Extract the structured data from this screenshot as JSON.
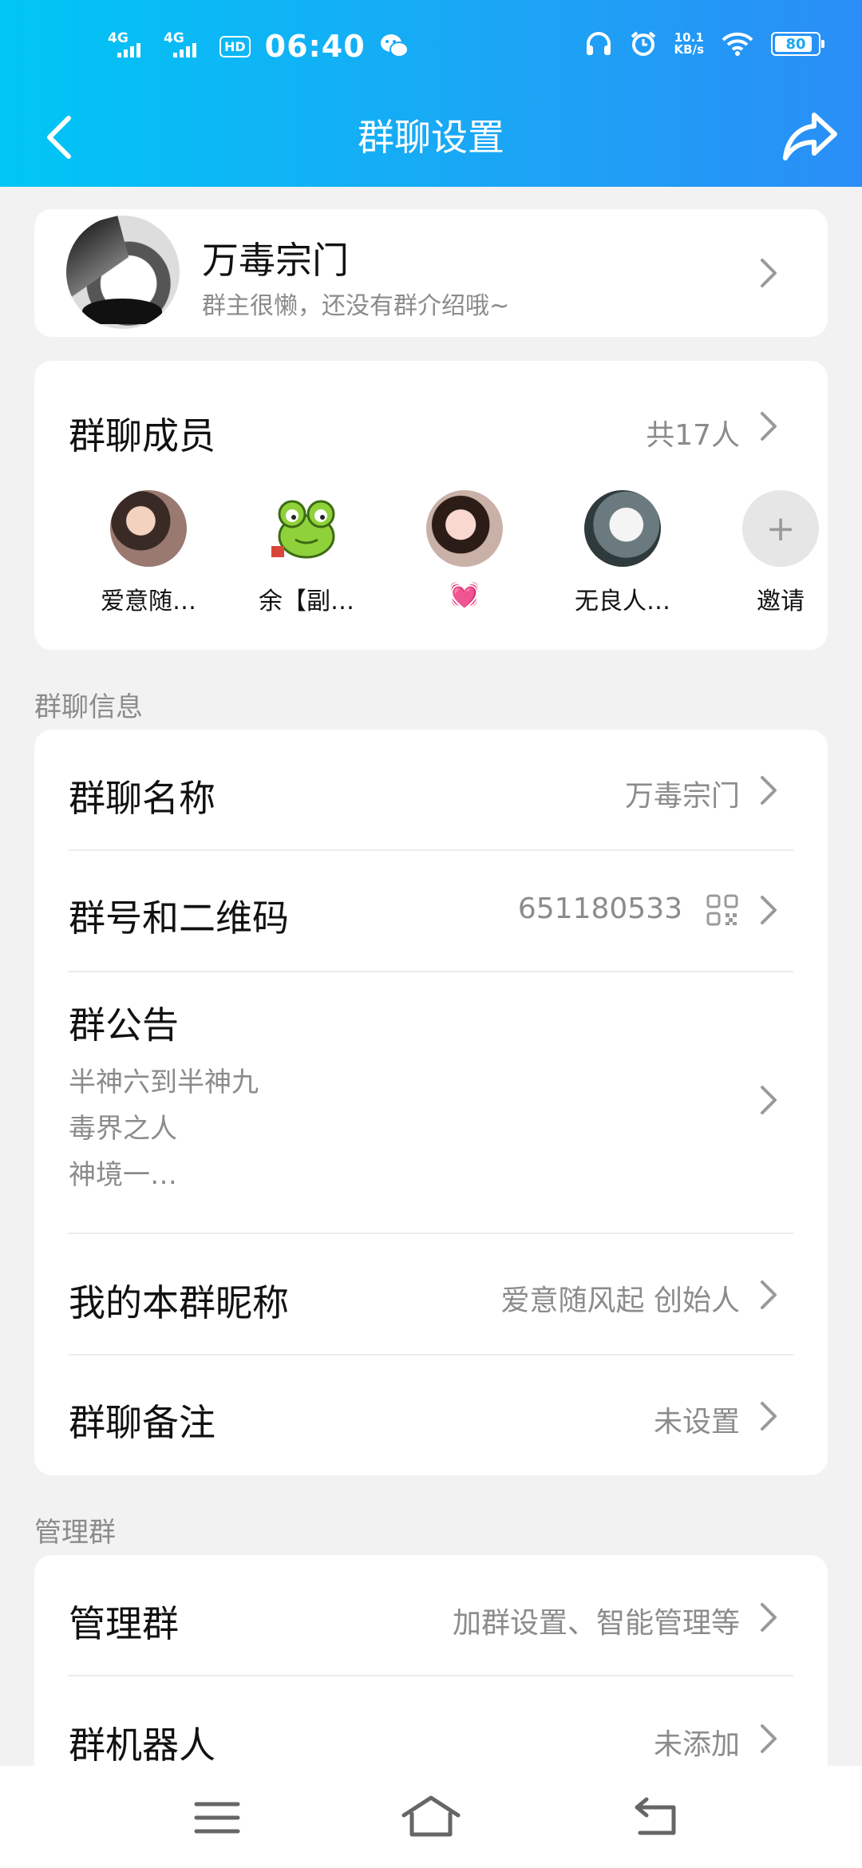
{
  "status_bar": {
    "signal1": "4G",
    "signal2": "4G",
    "hd": "HD",
    "time": "06:40",
    "speed_value": "10.1",
    "speed_unit": "KB/s",
    "battery": "80"
  },
  "header": {
    "title": "群聊设置",
    "back_icon": "chevron-left-icon",
    "share_icon": "share-forward-icon"
  },
  "group": {
    "name": "万毒宗门",
    "description": "群主很懒，还没有群介绍哦~"
  },
  "members_section": {
    "title": "群聊成员",
    "count": "共17人",
    "members": [
      {
        "name": "爱意随…"
      },
      {
        "name": "余【副…"
      },
      {
        "name": "💓"
      },
      {
        "name": "无良人…"
      }
    ],
    "invite_label": "邀请",
    "invite_icon": "+"
  },
  "info_section": {
    "label": "群聊信息",
    "rows": {
      "name": {
        "title": "群聊名称",
        "value": "万毒宗门"
      },
      "number": {
        "title": "群号和二维码",
        "value": "651180533"
      },
      "notice": {
        "title": "群公告",
        "lines": [
          "半神六到半神九",
          "毒界之人",
          "神境一…"
        ]
      },
      "nickname": {
        "title": "我的本群昵称",
        "value": "爱意随风起 创始人"
      },
      "remark": {
        "title": "群聊备注",
        "value": "未设置"
      }
    }
  },
  "manage_section": {
    "label": "管理群",
    "rows": {
      "manage": {
        "title": "管理群",
        "value": "加群设置、智能管理等"
      },
      "robot": {
        "title": "群机器人",
        "value": "未添加"
      }
    }
  },
  "colors": {
    "header_start": "#00c6f5",
    "header_end": "#2a8ef6",
    "secondary_text": "#8b8b8b",
    "background": "#f2f2f2"
  }
}
